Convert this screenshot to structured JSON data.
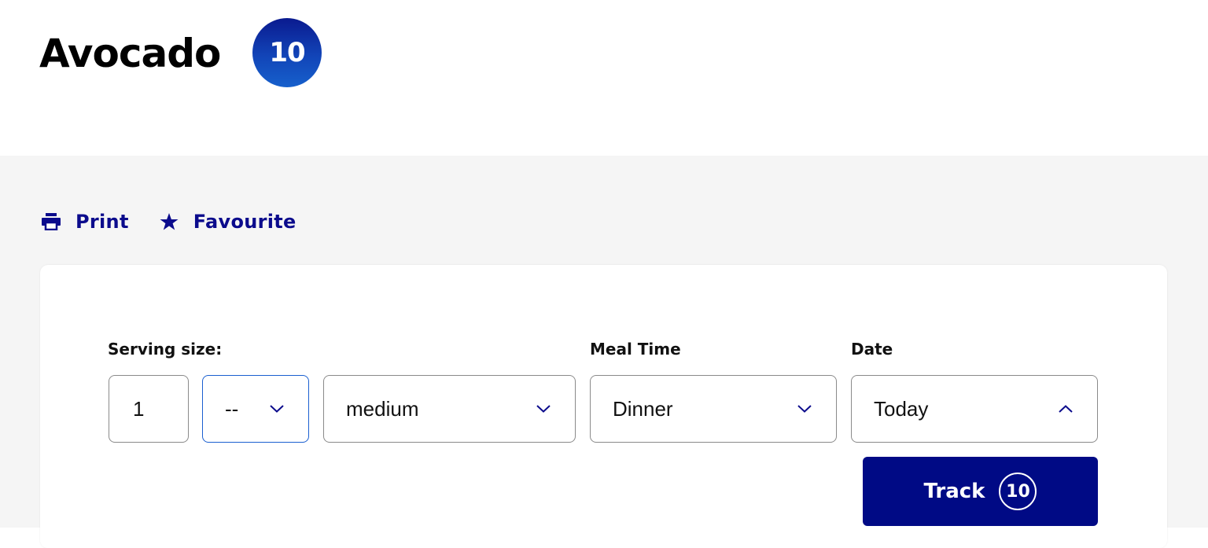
{
  "header": {
    "title": "Avocado",
    "score": "10"
  },
  "actions": {
    "print_label": "Print",
    "favourite_label": "Favourite"
  },
  "form": {
    "serving_size_label": "Serving size:",
    "quantity_value": "1",
    "fraction_value": "--",
    "unit_value": "medium",
    "meal_time_label": "Meal Time",
    "meal_time_value": "Dinner",
    "date_label": "Date",
    "date_value": "Today"
  },
  "track": {
    "label": "Track",
    "score": "10"
  },
  "colors": {
    "brand_navy": "#000a85",
    "link_navy": "#0b0b8c",
    "focus_blue": "#1a5fd0",
    "badge_gradient_top": "#0a1a8f",
    "badge_gradient_bottom": "#1660cc"
  }
}
